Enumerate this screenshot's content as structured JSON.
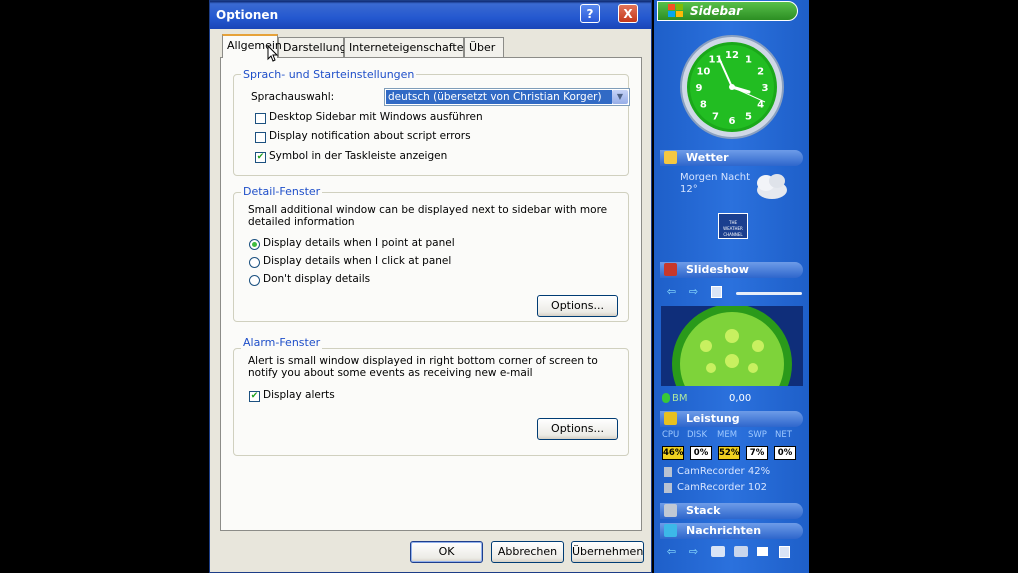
{
  "dialog": {
    "title": "Optionen",
    "title_buttons": {
      "help": "?",
      "close": "X"
    },
    "tabs": [
      "Allgemein",
      "Darstellung",
      "Interneteigenschaften",
      "Über"
    ],
    "language_group": {
      "title": "Sprach- und Starteinstellungen",
      "language_label": "Sprachauswahl:",
      "language_value": "deutsch (übersetzt von Christian Korger)",
      "checkboxes": [
        {
          "label": "Desktop Sidebar mit Windows ausführen",
          "checked": false
        },
        {
          "label": "Display notification about script errors",
          "checked": false
        },
        {
          "label": "Symbol in der Taskleiste anzeigen",
          "checked": true
        }
      ]
    },
    "detail_group": {
      "title": "Detail-Fenster",
      "description": "Small additional window can be displayed next to sidebar with more detailed information",
      "radios": [
        {
          "label": "Display details when I point at panel",
          "selected": true
        },
        {
          "label": "Display details when I click at panel",
          "selected": false
        },
        {
          "label": "Don't display details",
          "selected": false
        }
      ],
      "options_button": "Options..."
    },
    "alarm_group": {
      "title": "Alarm-Fenster",
      "description": "Alert is small window displayed in right bottom corner of screen to notify you about some events as receiving new e-mail",
      "checkbox": {
        "label": "Display alerts",
        "checked": true
      },
      "options_button": "Options..."
    },
    "footer": {
      "ok": "OK",
      "cancel": "Abbrechen",
      "apply": "Übernehmen"
    }
  },
  "sidebar": {
    "title": "Sidebar",
    "clock_numbers": [
      "12",
      "1",
      "2",
      "3",
      "4",
      "5",
      "6",
      "7",
      "8",
      "9",
      "10",
      "11"
    ],
    "weather": {
      "title": "Wetter",
      "line1": "Morgen Nacht",
      "line2": "12°",
      "logo_text": "THE WEATHER CHANNEL"
    },
    "slideshow": {
      "title": "Slideshow"
    },
    "media": {
      "label": "BM",
      "value": "0,00"
    },
    "performance": {
      "title": "Leistung",
      "headers": [
        "CPU",
        "DISK",
        "MEM",
        "SWP",
        "NET"
      ],
      "values": [
        "46%",
        "0%",
        "52%",
        "7%",
        "0%"
      ],
      "processes": [
        "CamRecorder 42%",
        "CamRecorder 102"
      ]
    },
    "stack": {
      "title": "Stack"
    },
    "news": {
      "title": "Nachrichten"
    },
    "colors": {
      "sidebar_blue": "#2b71dd",
      "header_green": "#2c8e23",
      "selection_blue": "#316ac5"
    }
  }
}
